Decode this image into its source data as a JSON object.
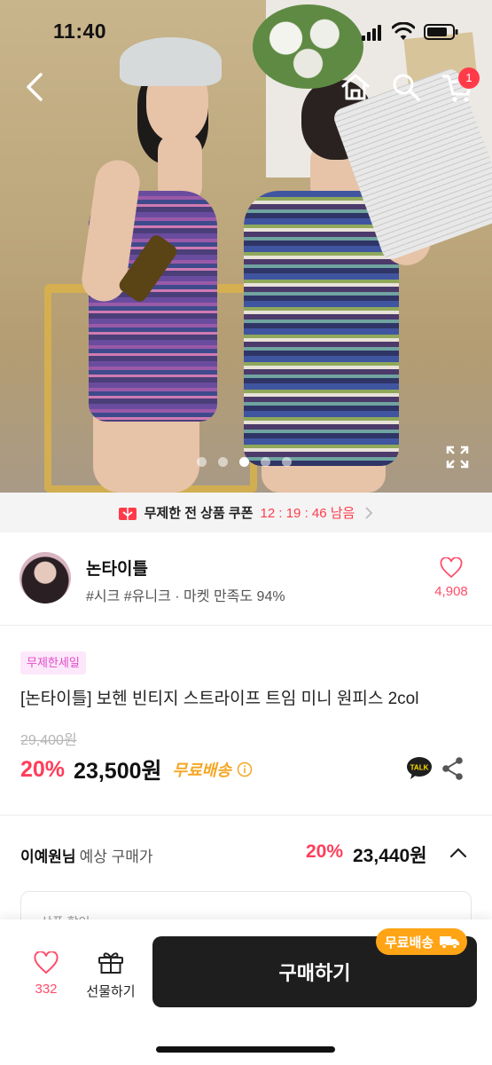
{
  "status_bar": {
    "time": "11:40"
  },
  "header": {
    "cart_badge": "1"
  },
  "carousel": {
    "total_slides": 5,
    "active_slide": 3
  },
  "coupon_bar": {
    "label": "무제한 전 상품 쿠폰",
    "countdown": "12 : 19 : 46 남음"
  },
  "shop": {
    "name": "논타이틀",
    "meta": "#시크 #유니크 · 마켓 만족도 94%",
    "likes": "4,908"
  },
  "product": {
    "badge": "무제한세일",
    "title": "[논타이틀] 보헨 빈티지 스트라이프 트임 미니 원피스 2col",
    "original_price": "29,400원",
    "discount": "20%",
    "price": "23,500원",
    "shipping": "무료배송"
  },
  "expected_price": {
    "user": "이예원님",
    "label": "예상 구매가",
    "discount": "20%",
    "amount": "23,440원"
  },
  "detail_card": {
    "text": "상품 할인"
  },
  "bottom_bar": {
    "likes": "332",
    "gift_label": "선물하기",
    "buy_label": "구매하기",
    "shipping_tag": "무료배송"
  },
  "colors": {
    "accent_red": "#ff3d5a",
    "shipping_orange": "#ffa415",
    "buy_button": "#1e1e1e",
    "badge_pink": "#e04bc8"
  },
  "icons": [
    "back-icon",
    "home-icon",
    "search-icon",
    "cart-icon",
    "expand-icon",
    "gift-icon",
    "chevron-right-icon",
    "heart-icon",
    "info-icon",
    "kakaotalk-icon",
    "share-icon",
    "chevron-up-icon",
    "truck-icon"
  ]
}
